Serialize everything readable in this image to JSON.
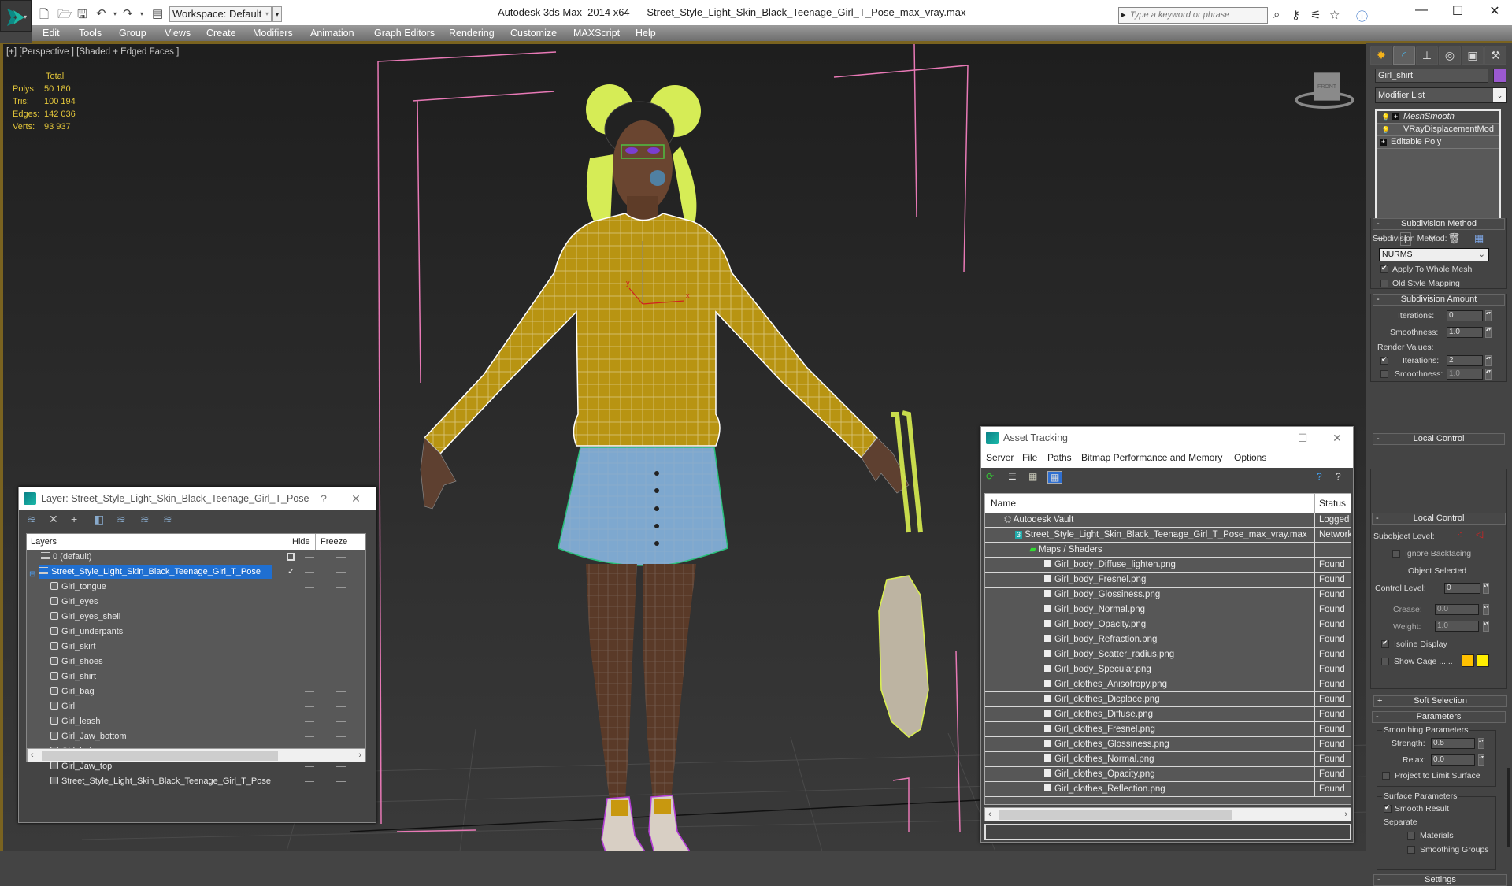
{
  "titlebar": {
    "workspace": "Workspace: Default",
    "app_title": "Autodesk 3ds Max  2014 x64",
    "file_title": "Street_Style_Light_Skin_Black_Teenage_Girl_T_Pose_max_vray.max",
    "search_placeholder": "Type a keyword or phrase",
    "icons": [
      "new-file-icon",
      "open-file-icon",
      "save-icon",
      "undo-icon",
      "redo-icon",
      "project-folder-icon",
      "binoculars-icon",
      "key-icon",
      "satellite-icon",
      "star-icon",
      "help-icon"
    ]
  },
  "menu": [
    "Edit",
    "Tools",
    "Group",
    "Views",
    "Create",
    "Modifiers",
    "Animation",
    "Graph Editors",
    "Rendering",
    "Customize",
    "MAXScript",
    "Help"
  ],
  "viewport": {
    "label": "[+] [Perspective ] [Shaded + Edged Faces ]",
    "stats": {
      "header": "Total",
      "rows": [
        {
          "k": "Polys:",
          "v": "50 180"
        },
        {
          "k": "Tris:",
          "v": "100 194"
        },
        {
          "k": "Edges:",
          "v": "142 036"
        },
        {
          "k": "Verts:",
          "v": "93 937"
        }
      ]
    },
    "viewcube_label": "FRONT",
    "axis_x": "x",
    "axis_y": "y"
  },
  "command_panel": {
    "object_name": "Girl_shirt",
    "object_color": "#9b59d0",
    "modifier_list": "Modifier List",
    "stack": [
      "MeshSmooth",
      "VRayDisplacementMod",
      "Editable Poly"
    ],
    "subdivision_method": {
      "title": "Subdivision Method",
      "label": "Subdivision Method:",
      "value": "NURMS",
      "apply_whole_mesh": "Apply To Whole Mesh",
      "old_style_mapping": "Old Style Mapping"
    },
    "subdivision_amount": {
      "title": "Subdivision Amount",
      "iterations_label": "Iterations:",
      "iterations": "0",
      "smoothness_label": "Smoothness:",
      "smoothness": "1.0",
      "render_values": "Render Values:",
      "render_iterations_label": "Iterations:",
      "render_iterations": "2",
      "render_smoothness_label": "Smoothness:",
      "render_smoothness": "1.0"
    },
    "local_control": {
      "title": "Local Control",
      "subobject_label": "Subobject Level:",
      "ignore_backfacing": "Ignore Backfacing",
      "object_selected": "Object Selected",
      "control_level_label": "Control Level:",
      "control_level": "0",
      "crease_label": "Crease:",
      "crease": "0.0",
      "weight_label": "Weight:",
      "weight": "1.0",
      "isoline_display": "Isoline Display",
      "show_cage": "Show Cage ......",
      "cage_color_1": "#ffc000",
      "cage_color_2": "#ffee00"
    },
    "soft_selection": {
      "title": "Soft Selection"
    },
    "parameters": {
      "title": "Parameters",
      "smoothing_group": "Smoothing Parameters",
      "strength_label": "Strength:",
      "strength": "0.5",
      "relax_label": "Relax:",
      "relax": "0.0",
      "project_limit": "Project to Limit Surface",
      "surface_group": "Surface Parameters",
      "smooth_result": "Smooth Result",
      "separate": "Separate",
      "materials": "Materials",
      "smoothing_groups": "Smoothing Groups"
    },
    "settings": {
      "title": "Settings"
    }
  },
  "layer_dialog": {
    "title": "Layer: Street_Style_Light_Skin_Black_Teenage_Girl_T_Pose",
    "help": "?",
    "columns": {
      "layers": "Layers",
      "hide": "Hide",
      "freeze": "Freeze"
    },
    "default_layer": "0 (default)",
    "active_layer": "Street_Style_Light_Skin_Black_Teenage_Girl_T_Pose",
    "objects": [
      "Girl_tongue",
      "Girl_eyes",
      "Girl_eyes_shell",
      "Girl_underpants",
      "Girl_skirt",
      "Girl_shoes",
      "Girl_shirt",
      "Girl_bag",
      "Girl",
      "Girl_leash",
      "Girl_Jaw_bottom",
      "Girl_hair",
      "Girl_Jaw_top",
      "Street_Style_Light_Skin_Black_Teenage_Girl_T_Pose"
    ]
  },
  "asset_dialog": {
    "title": "Asset Tracking",
    "menu": [
      "Server",
      "File",
      "Paths",
      "Bitmap Performance and Memory",
      "Options"
    ],
    "columns": {
      "name": "Name",
      "status": "Status"
    },
    "vault": {
      "name": "Autodesk Vault",
      "status": "Logged O"
    },
    "scene_file": {
      "name": "Street_Style_Light_Skin_Black_Teenage_Girl_T_Pose_max_vray.max",
      "status": "Network"
    },
    "maps_group": "Maps / Shaders",
    "files": [
      {
        "name": "Girl_body_Diffuse_lighten.png",
        "status": "Found"
      },
      {
        "name": "Girl_body_Fresnel.png",
        "status": "Found"
      },
      {
        "name": "Girl_body_Glossiness.png",
        "status": "Found"
      },
      {
        "name": "Girl_body_Normal.png",
        "status": "Found"
      },
      {
        "name": "Girl_body_Opacity.png",
        "status": "Found"
      },
      {
        "name": "Girl_body_Refraction.png",
        "status": "Found"
      },
      {
        "name": "Girl_body_Scatter_radius.png",
        "status": "Found"
      },
      {
        "name": "Girl_body_Specular.png",
        "status": "Found"
      },
      {
        "name": "Girl_clothes_Anisotropy.png",
        "status": "Found"
      },
      {
        "name": "Girl_clothes_Dicplace.png",
        "status": "Found"
      },
      {
        "name": "Girl_clothes_Diffuse.png",
        "status": "Found"
      },
      {
        "name": "Girl_clothes_Fresnel.png",
        "status": "Found"
      },
      {
        "name": "Girl_clothes_Glossiness.png",
        "status": "Found"
      },
      {
        "name": "Girl_clothes_Normal.png",
        "status": "Found"
      },
      {
        "name": "Girl_clothes_Opacity.png",
        "status": "Found"
      },
      {
        "name": "Girl_clothes_Reflection.png",
        "status": "Found"
      }
    ]
  },
  "colors": {
    "viewport_border": "#7a6320",
    "selection_blue": "#1f6fd1",
    "stats_yellow": "#e3c63a",
    "bbox_pink": "#e879b6"
  }
}
